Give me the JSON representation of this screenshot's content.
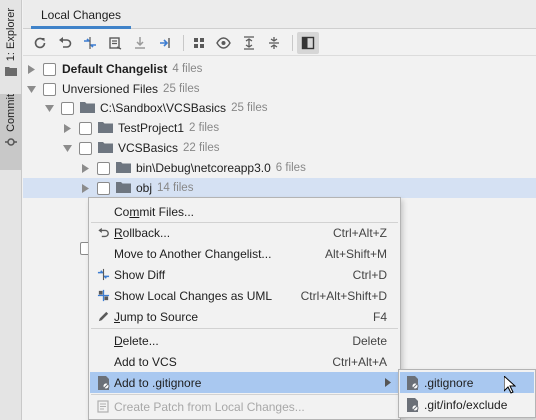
{
  "tool_strip": {
    "explorer_label": "1: Explorer",
    "commit_label": "Commit"
  },
  "header": {
    "tab_label": "Local Changes"
  },
  "toolbar": {
    "icons": [
      "refresh-icon",
      "rollback-icon",
      "diff-icon",
      "commit-icon",
      "update-icon",
      "shelve-icon",
      "group-by-icon",
      "eye-icon",
      "expand-all-icon",
      "collapse-all-icon",
      "preview-icon"
    ]
  },
  "tree": {
    "rows": [
      {
        "label": "Default Changelist",
        "count": "4 files"
      },
      {
        "label": "Unversioned Files",
        "count": "25 files"
      },
      {
        "label": "C:\\Sandbox\\VCSBasics",
        "count": "25 files"
      },
      {
        "label": "TestProject1",
        "count": "2 files"
      },
      {
        "label": "VCSBasics",
        "count": "22 files"
      },
      {
        "label": "bin\\Debug\\netcoreapp3.0",
        "count": "6 files"
      },
      {
        "label": "obj",
        "count": "14 files"
      }
    ]
  },
  "context_menu": {
    "commit_files": {
      "label_pre": "Co",
      "label_u": "m",
      "label_post": "mit Files..."
    },
    "rollback": {
      "label_u": "R",
      "label_post": "ollback...",
      "shortcut": "Ctrl+Alt+Z"
    },
    "move": {
      "label": "Move to Another Changelist...",
      "shortcut": "Alt+Shift+M"
    },
    "show_diff": {
      "label": "Show Diff",
      "shortcut": "Ctrl+D"
    },
    "show_uml": {
      "label": "Show Local Changes as UML",
      "shortcut": "Ctrl+Alt+Shift+D"
    },
    "jump": {
      "label_u": "J",
      "label_post": "ump to Source",
      "shortcut": "F4"
    },
    "delete": {
      "label_u": "D",
      "label_post": "elete...",
      "shortcut": "Delete"
    },
    "add_vcs": {
      "label": "Add to VCS",
      "shortcut": "Ctrl+Alt+A"
    },
    "add_gitignore": {
      "label": "Add to .gitignore"
    },
    "create_patch": {
      "label": "Create Patch from Local Changes..."
    }
  },
  "submenu": {
    "gitignore": ".gitignore",
    "exclude": ".git/info/exclude"
  },
  "colors": {
    "accent": "#4083c9",
    "selection": "#d5e1f3",
    "menu_highlight": "#a9c8f0"
  }
}
